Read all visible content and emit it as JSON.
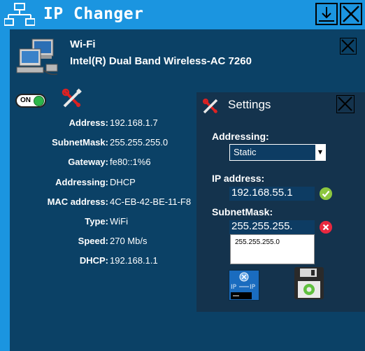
{
  "app": {
    "title": "IP Changer"
  },
  "adapter": {
    "type": "Wi-Fi",
    "name": "Intel(R) Dual Band Wireless-AC 7260",
    "toggle_label": "ON"
  },
  "info": {
    "rows": [
      {
        "key": "Address:",
        "value": "192.168.1.7"
      },
      {
        "key": "SubnetMask:",
        "value": "255.255.255.0"
      },
      {
        "key": "Gateway:",
        "value": "fe80::1%6"
      },
      {
        "key": "Addressing:",
        "value": "DHCP"
      },
      {
        "key": "MAC address:",
        "value": "4C-EB-42-BE-11-F8"
      },
      {
        "key": "Type:",
        "value": "WiFi"
      },
      {
        "key": "Speed:",
        "value": "270 Mb/s"
      },
      {
        "key": "DHCP:",
        "value": "192.168.1.1"
      }
    ]
  },
  "settings": {
    "title": "Settings",
    "addressing_label": "Addressing:",
    "addressing_value": "Static",
    "ip_label": "IP address:",
    "ip_value": "192.168.55.1",
    "mask_label": "SubnetMask:",
    "mask_value": "255.255.255.",
    "mask_suggestion": "255.255.255.0"
  },
  "colors": {
    "titlebar": "#1b95e0",
    "panel": "#0b4166",
    "settings_panel": "#14334d",
    "ok": "#8cc63f",
    "error": "#e8283f"
  }
}
